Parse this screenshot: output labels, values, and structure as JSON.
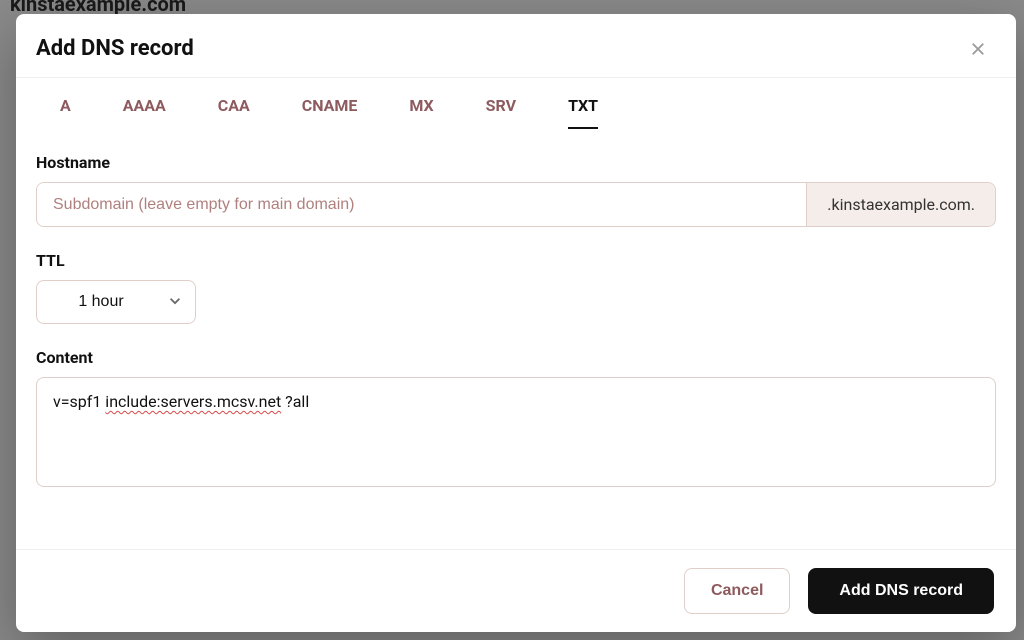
{
  "backdrop": {
    "domain": "kinstaexample.com"
  },
  "modal": {
    "title": "Add DNS record",
    "tabs": [
      {
        "label": "A",
        "active": false
      },
      {
        "label": "AAAA",
        "active": false
      },
      {
        "label": "CAA",
        "active": false
      },
      {
        "label": "CNAME",
        "active": false
      },
      {
        "label": "MX",
        "active": false
      },
      {
        "label": "SRV",
        "active": false
      },
      {
        "label": "TXT",
        "active": true
      }
    ],
    "fields": {
      "hostname": {
        "label": "Hostname",
        "placeholder": "Subdomain (leave empty for main domain)",
        "value": "",
        "suffix": ".kinstaexample.com."
      },
      "ttl": {
        "label": "TTL",
        "selected": "1 hour"
      },
      "content": {
        "label": "Content",
        "value_prefix": "v=spf1 ",
        "value_spell": "include:servers.mcsv.net",
        "value_suffix": " ?all"
      }
    },
    "footer": {
      "cancel": "Cancel",
      "submit": "Add DNS record"
    }
  }
}
